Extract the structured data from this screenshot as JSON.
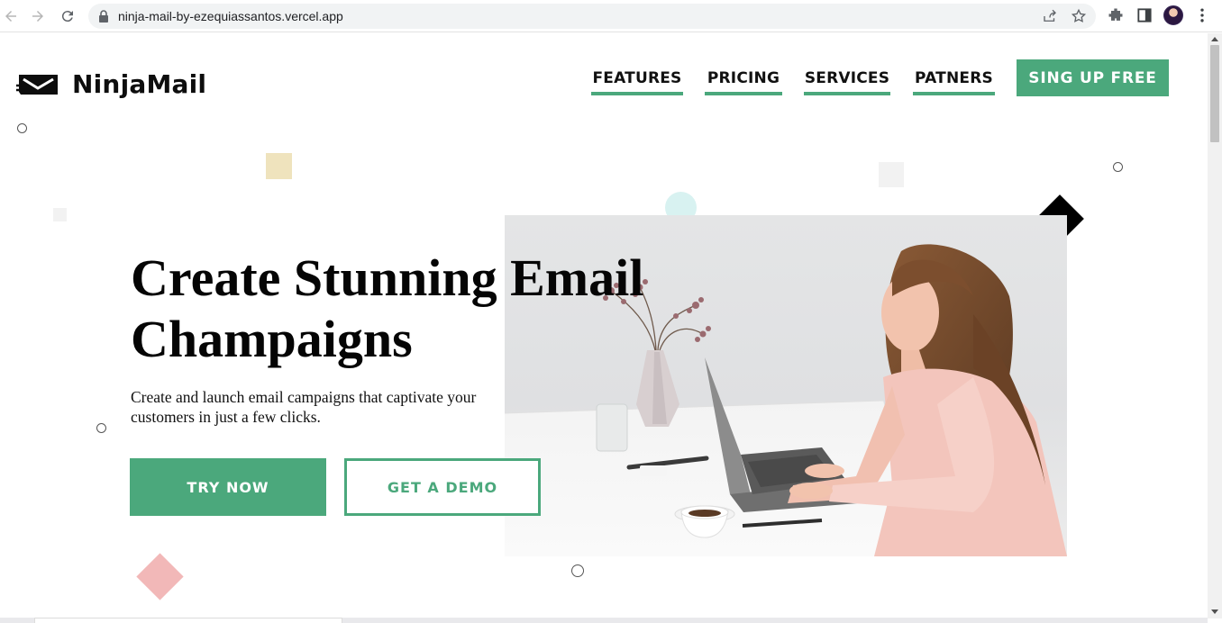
{
  "browser": {
    "url": "ninja-mail-by-ezequiassantos.vercel.app"
  },
  "site": {
    "logo_text": "NinjaMail",
    "nav": [
      {
        "label": "FEATURES"
      },
      {
        "label": "PRICING"
      },
      {
        "label": "SERVICES"
      },
      {
        "label": "PATNERS"
      }
    ],
    "cta_label": "SING UP FREE"
  },
  "hero": {
    "title_line1": "Create Stunning Email",
    "title_line2": "Champaigns",
    "subtitle": "Create and launch email campaigns that captivate your customers in just a few clicks.",
    "primary_button": "TRY NOW",
    "secondary_button": "GET A DEMO"
  },
  "colors": {
    "brand_green": "#4ba87c",
    "deco_beige": "#efe3bd",
    "deco_pink": "#f2b8b8",
    "deco_teal": "#d8f2f1"
  },
  "icons": [
    "back-arrow-icon",
    "forward-arrow-icon",
    "reload-icon",
    "lock-icon",
    "share-icon",
    "star-icon",
    "extensions-icon",
    "side-panel-icon",
    "more-vert-icon",
    "ninja-logo-icon"
  ]
}
